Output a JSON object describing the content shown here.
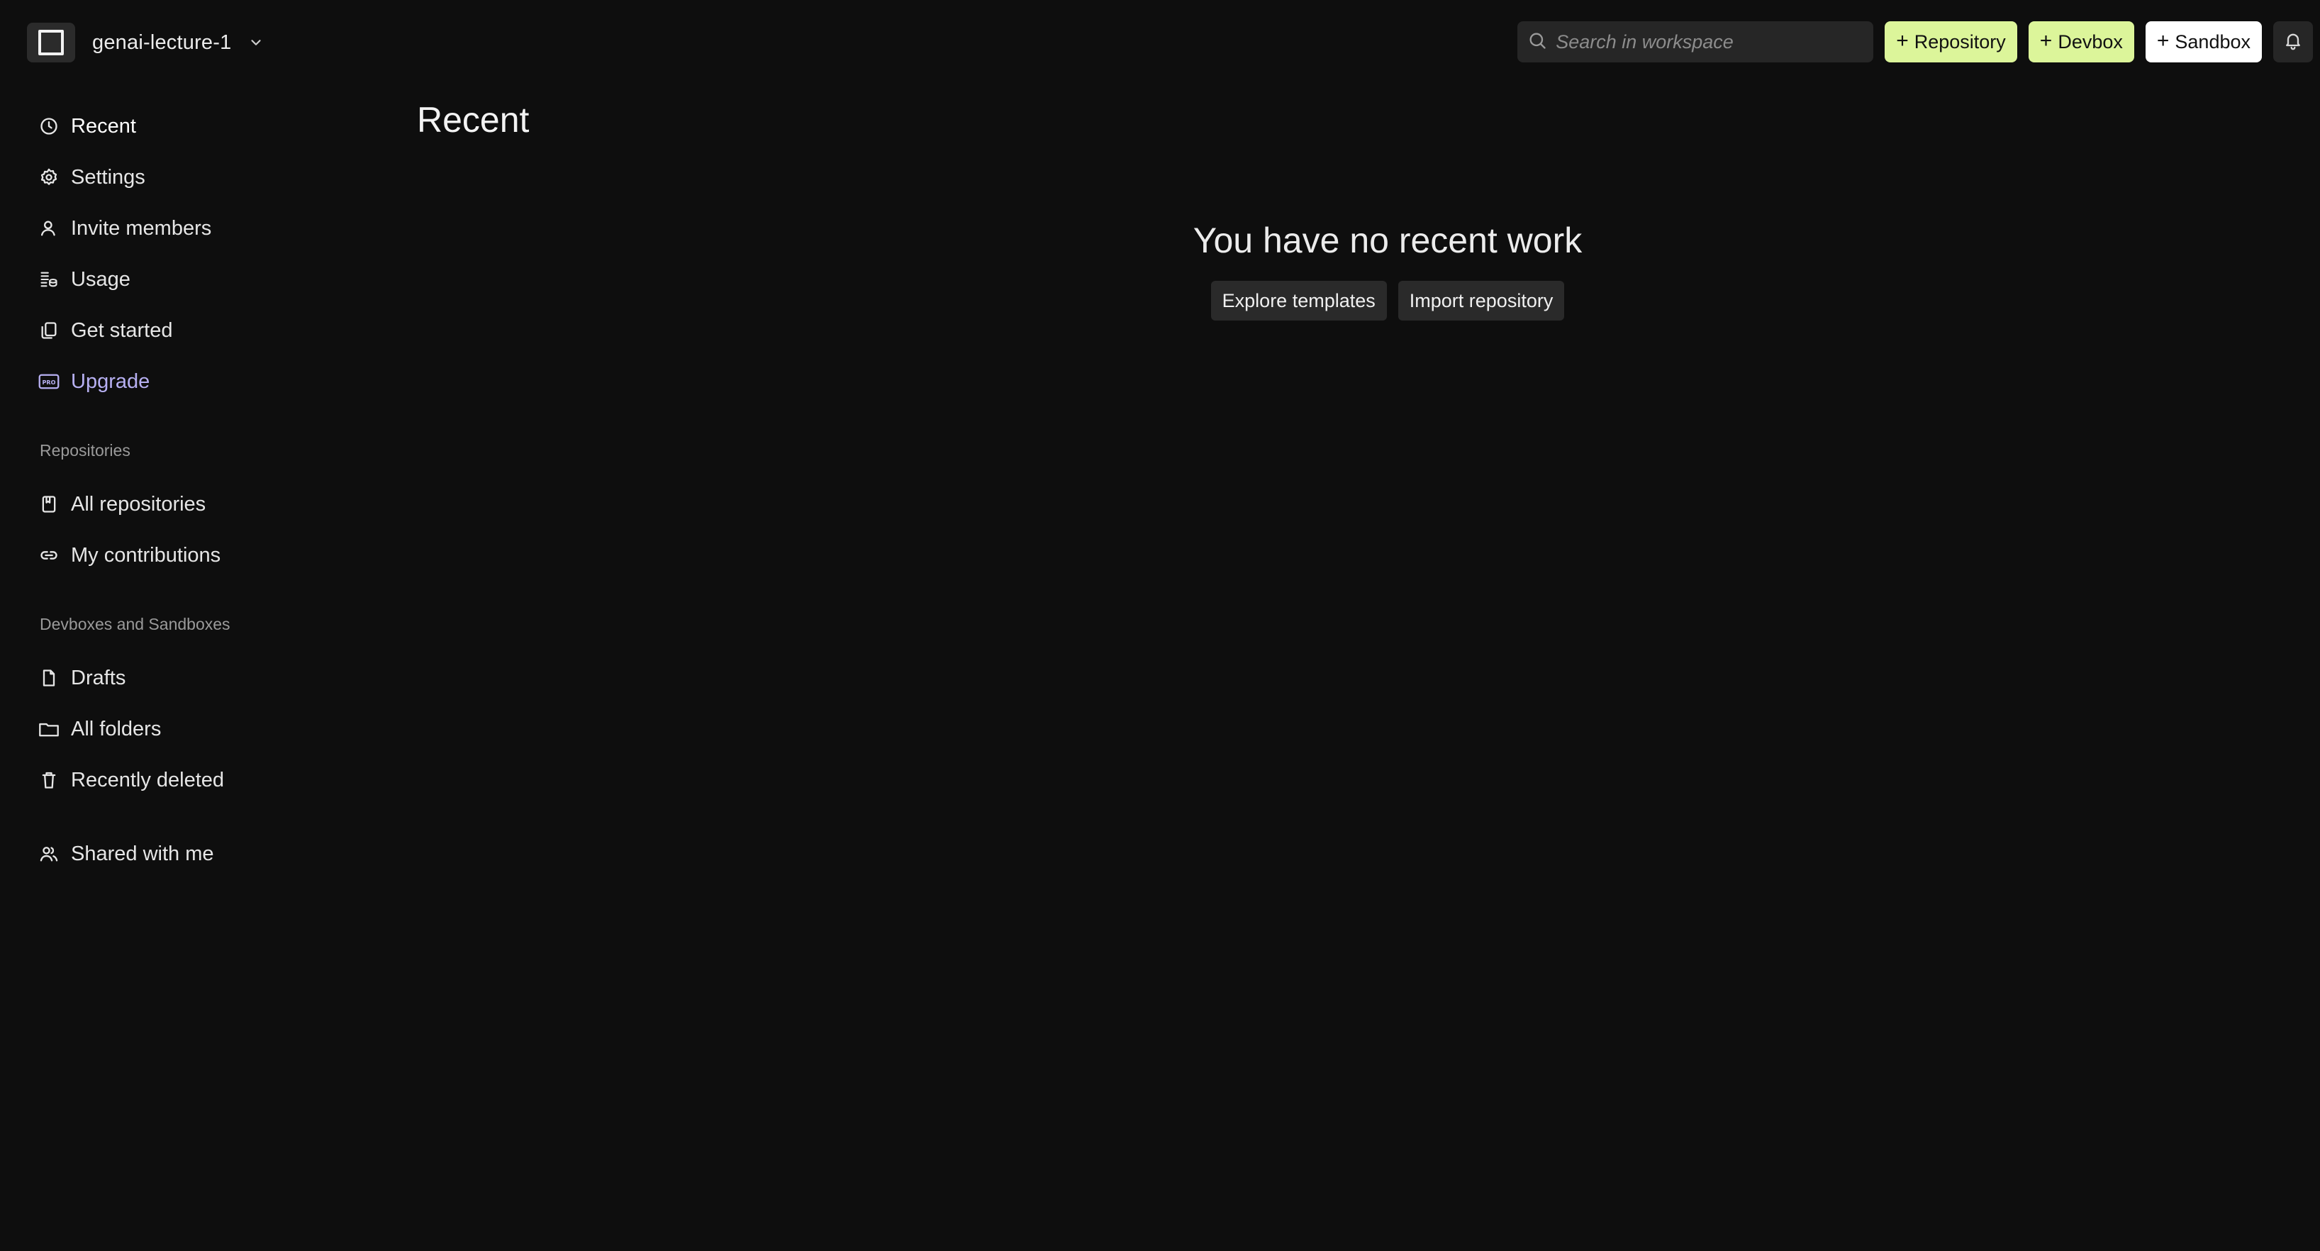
{
  "workspace": {
    "name": "genai-lecture-1",
    "logo_icon": "square-logo-icon",
    "chevron_icon": "chevron-down-icon"
  },
  "topbar": {
    "search_placeholder": "Search in workspace",
    "buttons": [
      {
        "label": "Repository",
        "style": "lime",
        "color": "#dcf59a",
        "icon": "plus-icon"
      },
      {
        "label": "Devbox",
        "style": "lime",
        "color": "#dcf59a",
        "icon": "plus-icon"
      },
      {
        "label": "Sandbox",
        "style": "white",
        "color": "#ffffff",
        "icon": "plus-icon"
      }
    ],
    "notification_icon": "bell-icon"
  },
  "sidebar": {
    "main_items": [
      {
        "label": "Recent",
        "icon": "clock-icon",
        "active": true
      },
      {
        "label": "Settings",
        "icon": "gear-icon"
      },
      {
        "label": "Invite members",
        "icon": "user-icon"
      },
      {
        "label": "Usage",
        "icon": "coins-icon"
      },
      {
        "label": "Get started",
        "icon": "copy-icon"
      },
      {
        "label": "Upgrade",
        "icon": "pro-badge-icon",
        "color": "#b7b0f2"
      }
    ],
    "repositories_heading": "Repositories",
    "repository_items": [
      {
        "label": "All repositories",
        "icon": "book-icon"
      },
      {
        "label": "My contributions",
        "icon": "link-icon"
      }
    ],
    "devboxes_heading": "Devboxes and Sandboxes",
    "devbox_items": [
      {
        "label": "Drafts",
        "icon": "file-icon"
      },
      {
        "label": "All folders",
        "icon": "folder-icon"
      },
      {
        "label": "Recently deleted",
        "icon": "trash-icon"
      }
    ],
    "shared_item": {
      "label": "Shared with me",
      "icon": "users-icon"
    }
  },
  "main": {
    "title": "Recent",
    "empty_message": "You have no recent work",
    "actions": [
      {
        "label": "Explore templates"
      },
      {
        "label": "Import repository"
      }
    ]
  },
  "colors": {
    "background": "#0e0e0e",
    "accent_lime": "#dcf59a",
    "upgrade_purple": "#b7b0f2"
  }
}
